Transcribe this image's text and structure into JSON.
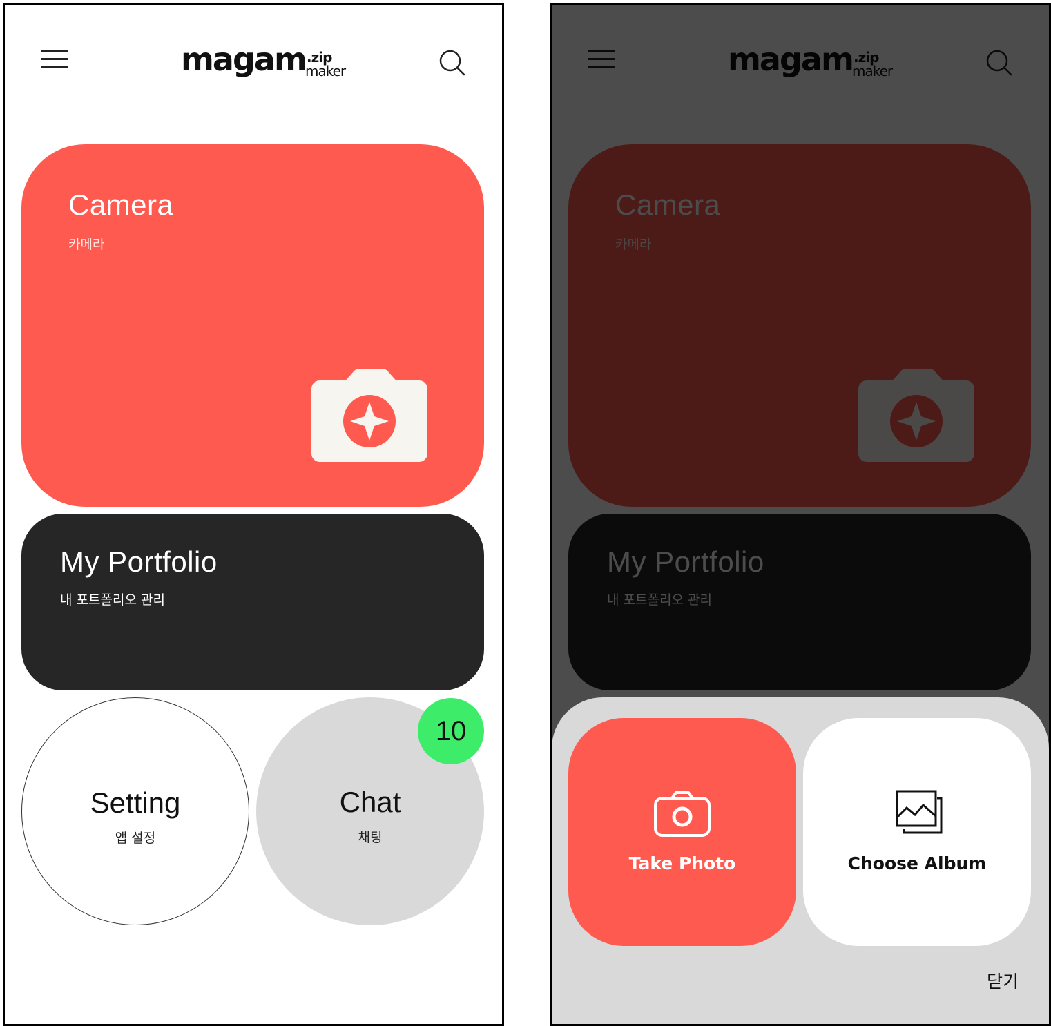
{
  "app": {
    "logo_main": "magam",
    "logo_zip": ".zip",
    "logo_maker": "maker"
  },
  "cards": {
    "camera": {
      "title": "Camera",
      "subtitle": "카메라"
    },
    "portfolio": {
      "title": "My Portfolio",
      "subtitle": "내 포트폴리오 관리"
    },
    "setting": {
      "title": "Setting",
      "subtitle": "앱 설정"
    },
    "chat": {
      "title": "Chat",
      "subtitle": "채팅",
      "badge": "10"
    }
  },
  "sheet": {
    "take_photo": "Take Photo",
    "choose_album": "Choose Album",
    "close": "닫기"
  },
  "colors": {
    "accent": "#ff5a50",
    "dark": "#262626",
    "badge": "#3ded6a",
    "circle_gray": "#d9d9d9"
  },
  "icons": [
    "menu-icon",
    "search-icon",
    "camera-icon",
    "image-icon"
  ]
}
